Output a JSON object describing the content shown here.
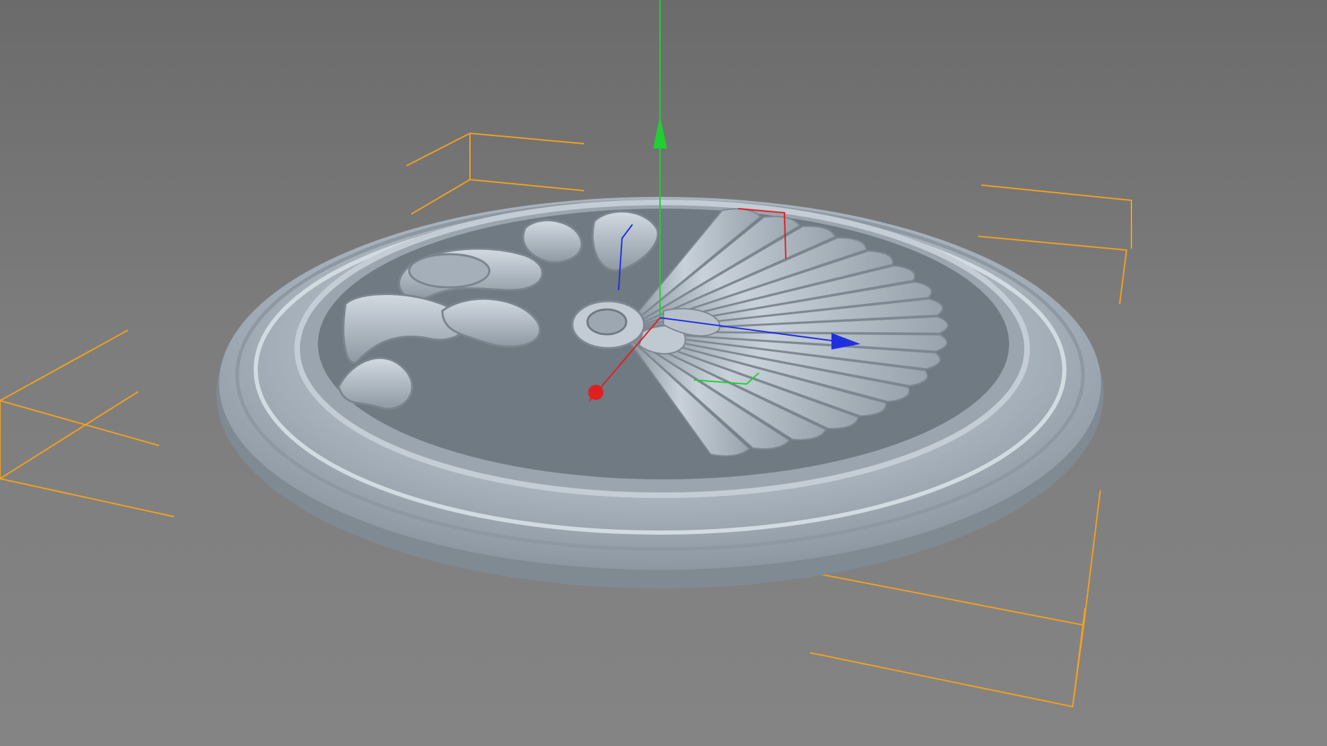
{
  "viewport": {
    "colors": {
      "background_top": "#6b6b6b",
      "background_bottom": "#848484",
      "model": "#a9b4be",
      "bounding_box": "#f0a020",
      "axis_x": "#e02020",
      "axis_y": "#20d030",
      "axis_z": "#2030e0"
    },
    "model": {
      "type": "round-ceiling-rosette",
      "flute_count": 18
    },
    "icons": {
      "gizmo": "move-gizmo-icon",
      "axis_x_handle": "x-axis-arrow-icon",
      "axis_y_handle": "y-axis-arrow-icon",
      "axis_z_handle": "z-axis-arrow-icon"
    }
  }
}
